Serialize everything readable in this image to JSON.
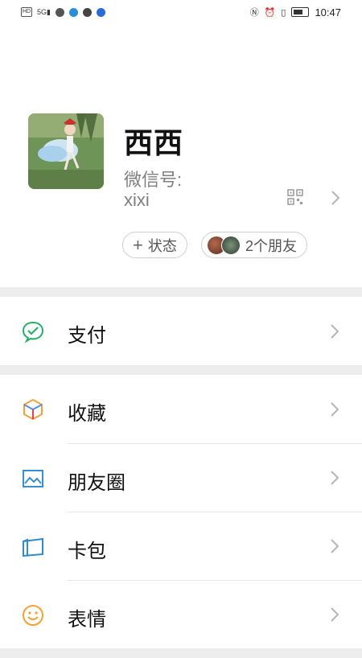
{
  "status_bar": {
    "time": "10:47"
  },
  "profile": {
    "name": "西西",
    "wechat_id_label": "微信号:",
    "wechat_id_value": "xixi",
    "status_button": "状态",
    "friends_button": "2个朋友"
  },
  "menu": {
    "pay": "支付",
    "favorites": "收藏",
    "moments": "朋友圈",
    "cards": "卡包",
    "stickers": "表情"
  },
  "colors": {
    "pay_green": "#2aae67",
    "chevron": "#b5b5b5",
    "band": "#ededed"
  }
}
